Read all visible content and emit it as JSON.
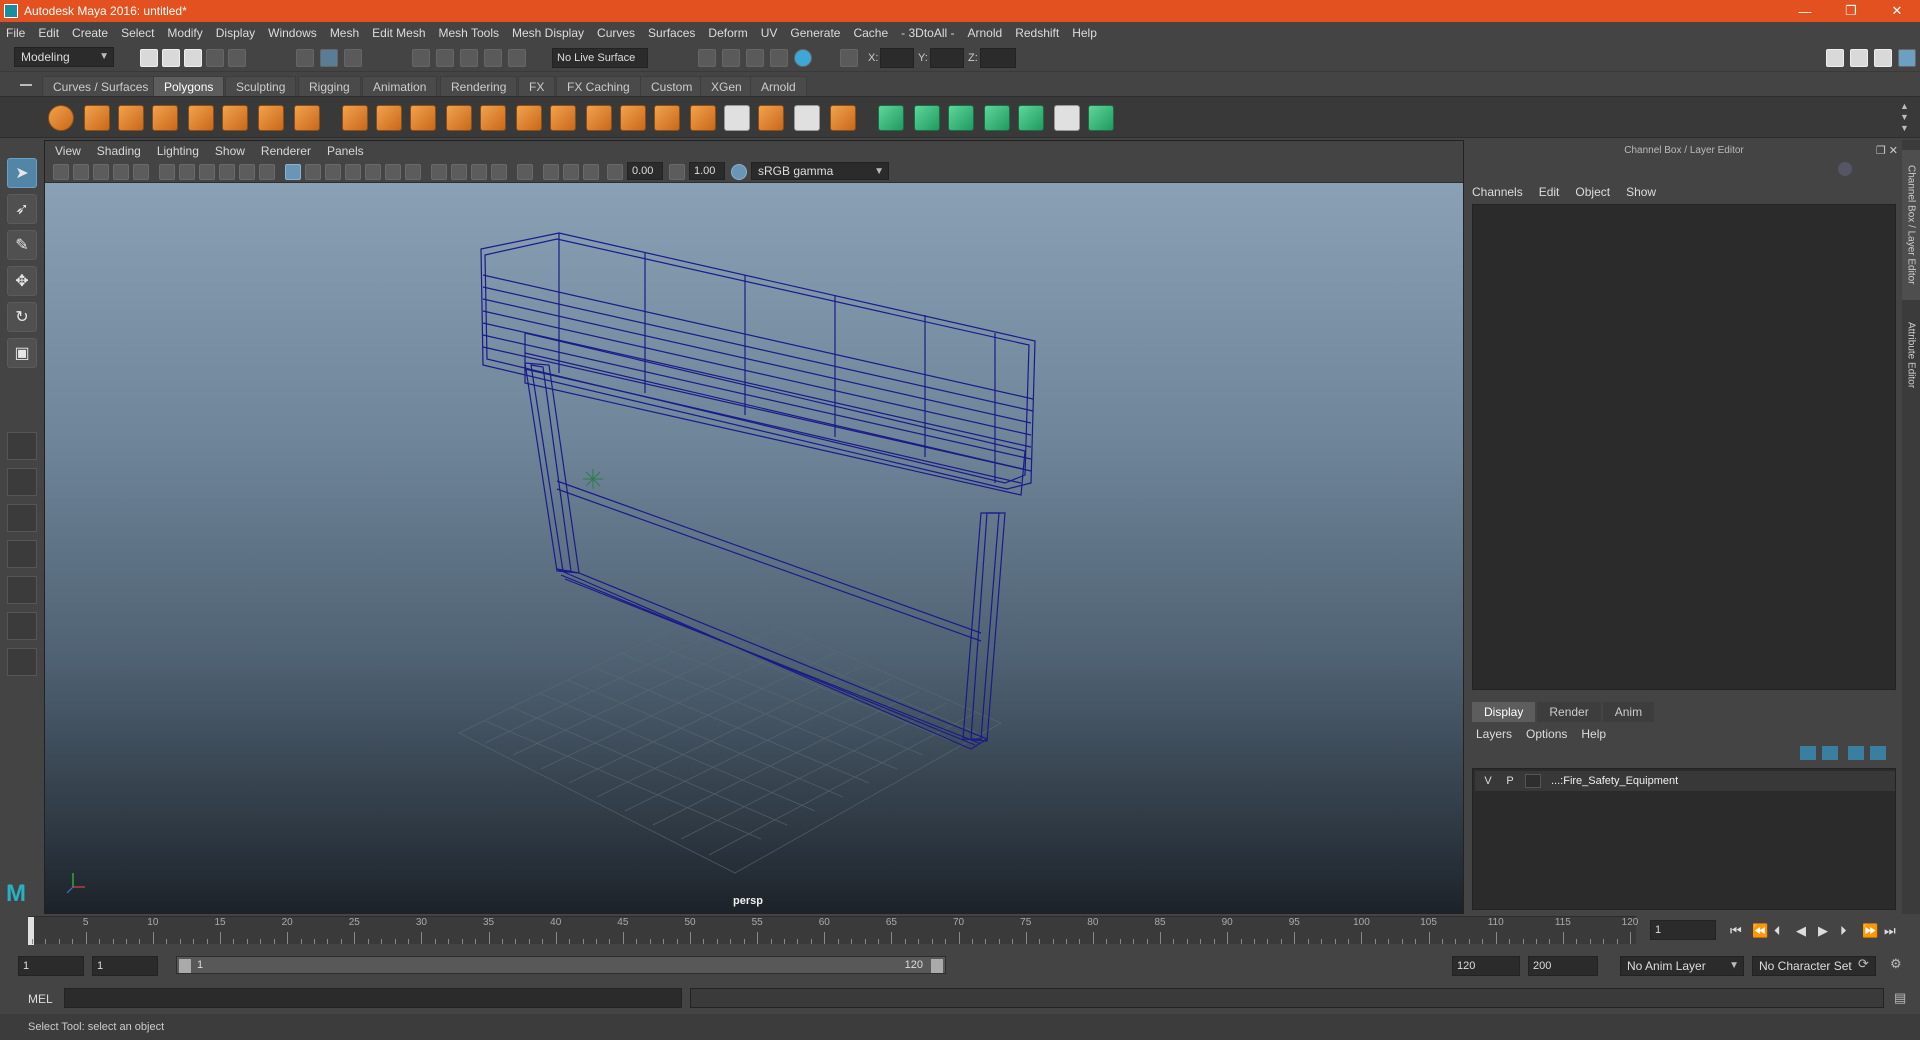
{
  "window": {
    "title": "Autodesk Maya 2016: untitled*",
    "controls": [
      "—",
      "❐",
      "✕"
    ]
  },
  "menubar": [
    "File",
    "Edit",
    "Create",
    "Select",
    "Modify",
    "Display",
    "Windows",
    "Mesh",
    "Edit Mesh",
    "Mesh Tools",
    "Mesh Display",
    "Curves",
    "Surfaces",
    "Deform",
    "UV",
    "Generate",
    "Cache",
    "- 3DtoAll -",
    "Arnold",
    "Redshift",
    "Help"
  ],
  "statusline": {
    "menuset": "Modeling",
    "live_surface": "No Live Surface",
    "x_label": "X:",
    "y_label": "Y:",
    "z_label": "Z:"
  },
  "shelf": {
    "tabs": [
      "Curves / Surfaces",
      "Polygons",
      "Sculpting",
      "Rigging",
      "Animation",
      "Rendering",
      "FX",
      "FX Caching",
      "Custom",
      "XGen",
      "Arnold"
    ],
    "active_tab": "Polygons"
  },
  "viewport": {
    "panel_menu": [
      "View",
      "Shading",
      "Lighting",
      "Show",
      "Renderer",
      "Panels"
    ],
    "exposure": "0.00",
    "gamma": "1.00",
    "color_space": "sRGB gamma",
    "camera_label": "persp",
    "wireframe_color": "#1a1a8a"
  },
  "channel_box": {
    "title": "Channel Box / Layer Editor",
    "menu": [
      "Channels",
      "Edit",
      "Object",
      "Show"
    ]
  },
  "layer_editor": {
    "tabs": [
      "Display",
      "Render",
      "Anim"
    ],
    "active_tab": "Display",
    "menu": [
      "Layers",
      "Options",
      "Help"
    ],
    "layers": [
      {
        "v": "V",
        "p": "P",
        "name": "...:Fire_Safety_Equipment"
      }
    ]
  },
  "side_tabs": [
    "Channel Box / Layer Editor",
    "Attribute Editor"
  ],
  "timeline": {
    "ticks": [
      5,
      10,
      15,
      20,
      25,
      30,
      35,
      40,
      45,
      50,
      55,
      60,
      65,
      70,
      75,
      80,
      85,
      90,
      95,
      100,
      105,
      110,
      115,
      120
    ],
    "current_frame": "1",
    "range_start": 1,
    "range_end": 120
  },
  "range": {
    "start": "1",
    "start_inner": "1",
    "slider_start": "1",
    "slider_end": "120",
    "end_inner": "120",
    "end": "200",
    "anim_layer": "No Anim Layer",
    "character_set": "No Character Set"
  },
  "command_line": {
    "label": "MEL"
  },
  "help_line": "Select Tool: select an object"
}
